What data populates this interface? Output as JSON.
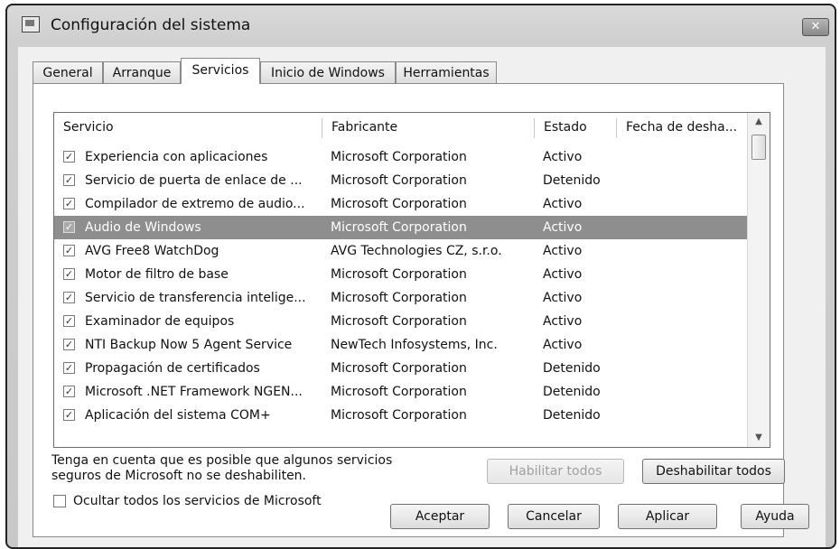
{
  "window": {
    "title": "Configuración del sistema",
    "close_glyph": "✕"
  },
  "tabs": [
    {
      "label": "General",
      "active": false
    },
    {
      "label": "Arranque",
      "active": false
    },
    {
      "label": "Servicios",
      "active": true
    },
    {
      "label": "Inicio de Windows",
      "active": false
    },
    {
      "label": "Herramientas",
      "active": false
    }
  ],
  "table": {
    "columns": [
      "Servicio",
      "Fabricante",
      "Estado",
      "Fecha de desha..."
    ],
    "rows": [
      {
        "checked": true,
        "service": "Experiencia con aplicaciones",
        "maker": "Microsoft Corporation",
        "state": "Activo",
        "date": "",
        "selected": false
      },
      {
        "checked": true,
        "service": "Servicio de puerta de enlace de ...",
        "maker": "Microsoft Corporation",
        "state": "Detenido",
        "date": "",
        "selected": false
      },
      {
        "checked": true,
        "service": "Compilador de extremo de audio...",
        "maker": "Microsoft Corporation",
        "state": "Activo",
        "date": "",
        "selected": false
      },
      {
        "checked": true,
        "service": "Audio de Windows",
        "maker": "Microsoft Corporation",
        "state": "Activo",
        "date": "",
        "selected": true
      },
      {
        "checked": true,
        "service": "AVG Free8 WatchDog",
        "maker": "AVG Technologies CZ, s.r.o.",
        "state": "Activo",
        "date": "",
        "selected": false
      },
      {
        "checked": true,
        "service": "Motor de filtro de base",
        "maker": "Microsoft Corporation",
        "state": "Activo",
        "date": "",
        "selected": false
      },
      {
        "checked": true,
        "service": "Servicio de transferencia intelige...",
        "maker": "Microsoft Corporation",
        "state": "Activo",
        "date": "",
        "selected": false
      },
      {
        "checked": true,
        "service": "Examinador de equipos",
        "maker": "Microsoft Corporation",
        "state": "Activo",
        "date": "",
        "selected": false
      },
      {
        "checked": true,
        "service": "NTI Backup Now 5 Agent Service",
        "maker": "NewTech Infosystems, Inc.",
        "state": "Activo",
        "date": "",
        "selected": false
      },
      {
        "checked": true,
        "service": "Propagación de certificados",
        "maker": "Microsoft Corporation",
        "state": "Detenido",
        "date": "",
        "selected": false
      },
      {
        "checked": true,
        "service": "Microsoft .NET Framework NGEN...",
        "maker": "Microsoft Corporation",
        "state": "Detenido",
        "date": "",
        "selected": false
      },
      {
        "checked": true,
        "service": "Aplicación del sistema COM+",
        "maker": "Microsoft Corporation",
        "state": "Detenido",
        "date": "",
        "selected": false
      }
    ]
  },
  "note": {
    "line1": "Tenga en cuenta que es posible que algunos servicios",
    "line2": "seguros de Microsoft no se deshabiliten."
  },
  "buttons": {
    "enable_all": "Habilitar todos",
    "disable_all": "Deshabilitar todos",
    "ok": "Aceptar",
    "cancel": "Cancelar",
    "apply": "Aplicar",
    "help": "Ayuda"
  },
  "hide_ms": {
    "label": "Ocultar todos los servicios de Microsoft",
    "checked": false
  },
  "check_glyph": "✓"
}
